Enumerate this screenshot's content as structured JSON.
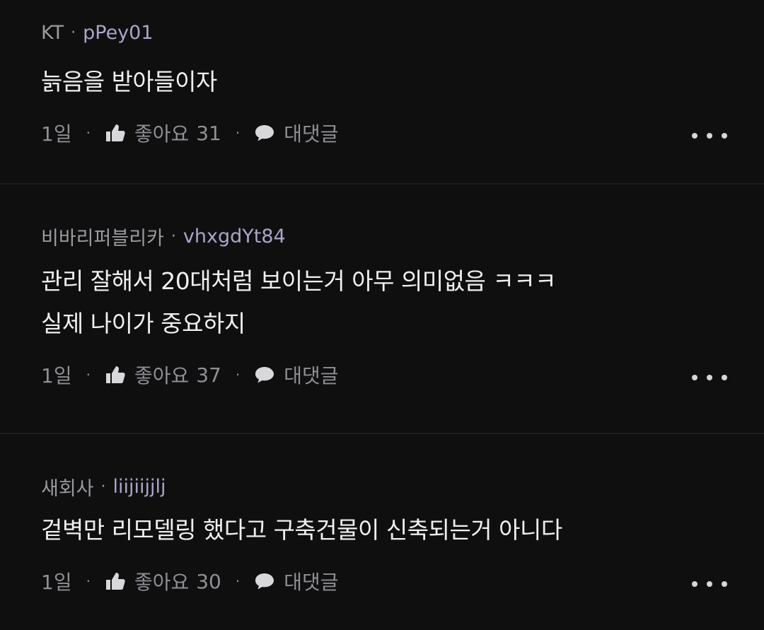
{
  "comments": [
    {
      "carrier": "KT",
      "user": "pPey01",
      "text": "늙음을 받아들이자",
      "time": "1일",
      "like_label": "좋아요",
      "like_count": "31",
      "reply_label": "대댓글"
    },
    {
      "carrier": "비바리퍼블리카",
      "user": "vhxgdYt84",
      "text": "관리 잘해서 20대처럼 보이는거 아무 의미없음 ㅋㅋㅋ\n실제 나이가 중요하지",
      "time": "1일",
      "like_label": "좋아요",
      "like_count": "37",
      "reply_label": "대댓글"
    },
    {
      "carrier": "새회사",
      "user": "liijiijjlj",
      "text": "겉벽만 리모델링 했다고 구축건물이 신축되는거 아니다",
      "time": "1일",
      "like_label": "좋아요",
      "like_count": "30",
      "reply_label": "대댓글"
    }
  ],
  "separator": "·",
  "icons": {
    "like": "thumbs-up-icon",
    "reply": "speech-bubble-icon",
    "more": "more-dots-icon"
  },
  "colors": {
    "background": "#0f0f10",
    "username": "#a9a6c8",
    "meta": "#9a9a9f"
  }
}
